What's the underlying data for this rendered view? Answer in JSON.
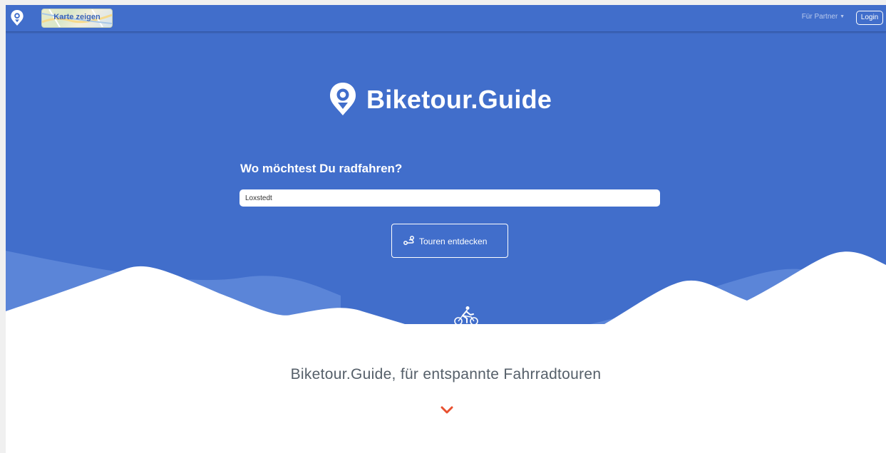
{
  "navbar": {
    "logo_icon": "map-pin-logo-icon",
    "map_button_label": "Karte zeigen",
    "partner_menu_label": "Für Partner",
    "partner_menu_icon": "caret-down-icon",
    "login_label": "Login"
  },
  "hero": {
    "brand_name": "Biketour.Guide",
    "brand_icon": "map-pin-logo-icon",
    "question": "Wo möchtest Du radfahren?",
    "search_value": "Loxstedt",
    "cta_label": "Touren entdecken",
    "cta_icon": "route-icon",
    "bike_icon": "cyclist-icon"
  },
  "content": {
    "tagline": "Biketour.Guide, für entspannte Fahrradtouren",
    "scroll_icon": "chevron-down-icon"
  },
  "colors": {
    "primary_blue": "#416ecb",
    "accent_red": "#e8502f",
    "white": "#ffffff"
  }
}
